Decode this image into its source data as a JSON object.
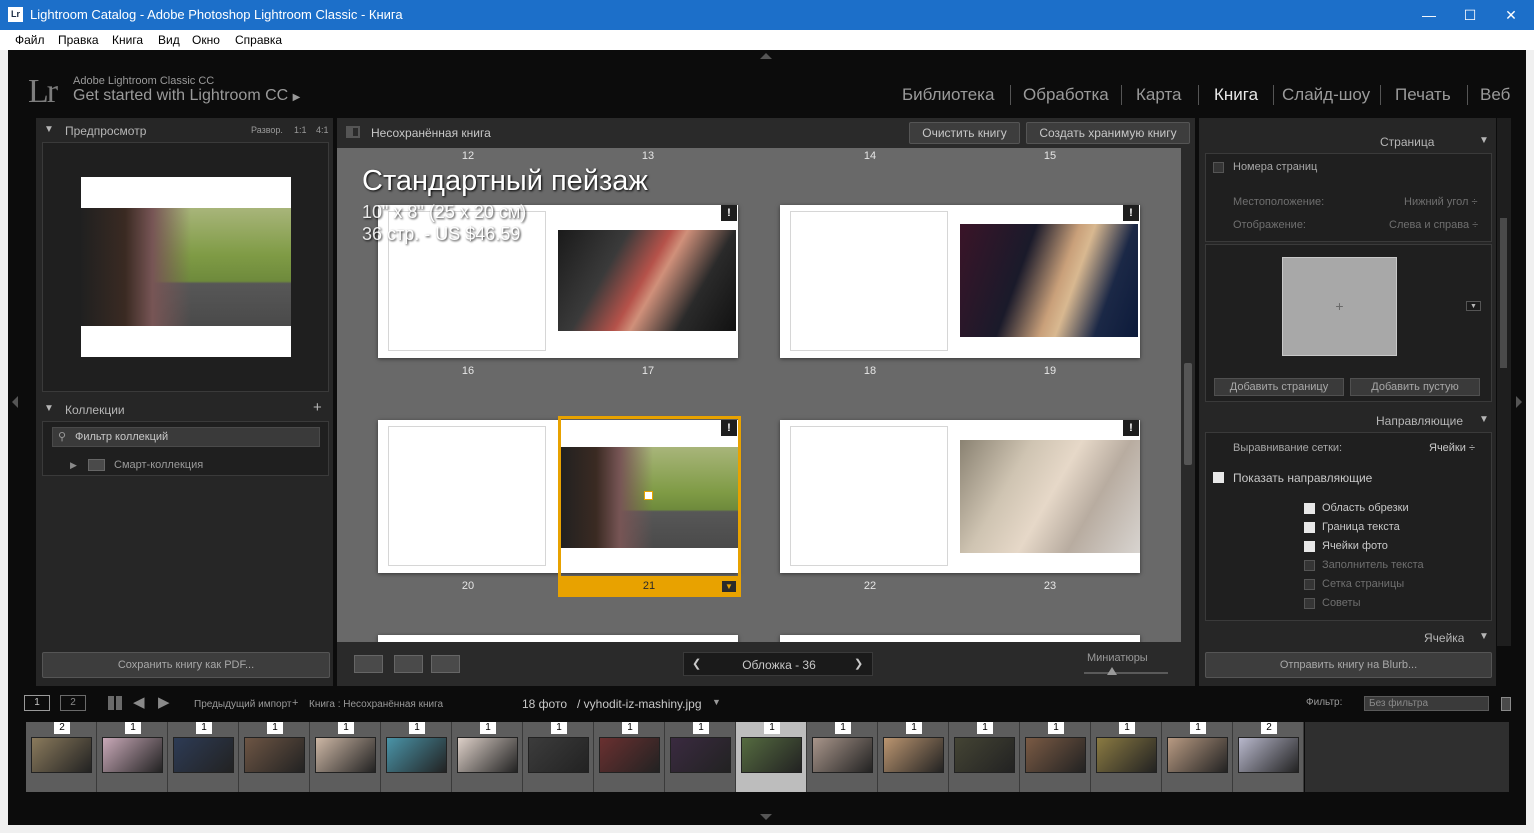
{
  "window": {
    "title": "Lightroom Catalog - Adobe Photoshop Lightroom Classic - Книга",
    "app_badge": "Lr",
    "minimize": "—",
    "maximize": "☐",
    "close": "✕"
  },
  "menu": [
    "Файл",
    "Правка",
    "Книга",
    "Вид",
    "Окно",
    "Справка"
  ],
  "identity": {
    "logo": "Lr",
    "top": "Adobe Lightroom Classic CC",
    "bottom": "Get started with Lightroom CC",
    "arrow": "▶"
  },
  "modules": [
    "Библиотека",
    "Обработка",
    "Карта",
    "Книга",
    "Слайд-шоу",
    "Печать",
    "Веб"
  ],
  "active_module": "Книга",
  "left": {
    "preview": {
      "title": "Предпросмотр",
      "opts": [
        "Развор.",
        "1:1",
        "4:1"
      ]
    },
    "collections": {
      "title": "Коллекции",
      "add": "+",
      "filter": "Фильтр коллекций",
      "smart": "Смарт-коллекция"
    },
    "pdf_button": "Сохранить книгу как PDF..."
  },
  "book": {
    "title": "Несохранённая книга",
    "clear": "Очистить книгу",
    "create": "Создать хранимую книгу"
  },
  "overlay": {
    "title": "Стандартный пейзаж",
    "size": "10\" x 8\" (25 x 20 см)",
    "price": "36 стр. - US $46.59"
  },
  "top_page_numbers": [
    "12",
    "13",
    "14",
    "15"
  ],
  "page_numbers": [
    "16",
    "17",
    "18",
    "19",
    "20",
    "21",
    "22",
    "23"
  ],
  "bottom_toolbar": {
    "nav": "Обложка - 36",
    "prev": "❮",
    "next": "❯",
    "thumbs_label": "Миниатюры"
  },
  "right": {
    "page": {
      "title": "Страница",
      "page_numbers": "Номера страниц",
      "position_label": "Местоположение:",
      "position_value": "Нижний угол ÷",
      "display_label": "Отображение:",
      "display_value": "Слева и справа ÷",
      "plus": "+",
      "add_page": "Добавить страницу",
      "add_blank": "Добавить пустую"
    },
    "guides": {
      "title": "Направляющие",
      "grid_label": "Выравнивание сетки:",
      "grid_value": "Ячейки ÷",
      "show": "Показать направляющие",
      "items": [
        {
          "label": "Область обрезки",
          "on": true
        },
        {
          "label": "Граница текста",
          "on": true
        },
        {
          "label": "Ячейки фото",
          "on": true
        },
        {
          "label": "Заполнитель текста",
          "on": false
        },
        {
          "label": "Сетка страницы",
          "on": false
        },
        {
          "label": "Советы",
          "on": false
        }
      ]
    },
    "cell": {
      "title": "Ячейка"
    },
    "send": "Отправить книгу на Blurb..."
  },
  "filmstrip": {
    "view1": "1",
    "view2": "2",
    "source": "Предыдущий импорт",
    "plus": "+",
    "path": "Книга : Несохранённая книга",
    "count": "18 фото",
    "file": "/ vyhodit-iz-mashiny.jpg",
    "filter_label": "Фильтр:",
    "filter_value": "Без фильтра",
    "counts": [
      "2",
      "1",
      "1",
      "1",
      "1",
      "1",
      "1",
      "1",
      "1",
      "1",
      "1",
      "1",
      "1",
      "1",
      "1",
      "1",
      "1",
      "2"
    ],
    "colors": [
      "#8a7a5c",
      "#c9a9b8",
      "#2d3b55",
      "#6d5544",
      "#cdb7a5",
      "#4a94a8",
      "#ddd0c8",
      "#3c3c3c",
      "#6a3030",
      "#3a2a40",
      "#556b40",
      "#a8958a",
      "#bb9570",
      "#444434",
      "#7a5a44",
      "#8a7a42",
      "#b89a82",
      "#b8b8cc"
    ]
  }
}
